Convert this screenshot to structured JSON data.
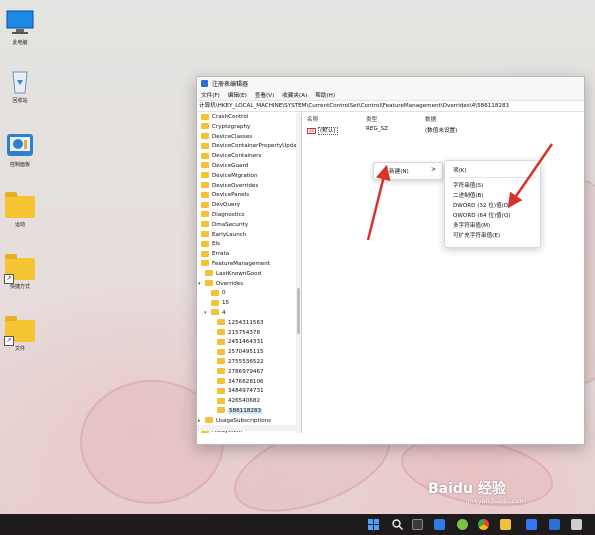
{
  "desktop": {
    "icons": [
      {
        "name": "this-pc-icon",
        "label": "此电脑"
      },
      {
        "name": "recycle-bin-icon",
        "label": "回收站"
      },
      {
        "name": "control-panel-icon",
        "label": "控制面板"
      },
      {
        "name": "folder-icon",
        "label": "运动"
      },
      {
        "name": "folder-shortcut-icon",
        "label": "快捷方式"
      },
      {
        "name": "folder-shortcut-icon",
        "label": "文件"
      }
    ]
  },
  "window": {
    "title": "注册表编辑器",
    "menu": [
      "文件(F)",
      "编辑(E)",
      "查看(V)",
      "收藏夹(A)",
      "帮助(H)"
    ],
    "address": "计算机\\HKEY_LOCAL_MACHINE\\SYSTEM\\CurrentControlSet\\Control\\FeatureManagement\\Overrides\\4\\586118283",
    "tree": [
      {
        "label": "CrashControl",
        "indent": 0
      },
      {
        "label": "Cryptography",
        "indent": 0
      },
      {
        "label": "DeviceClasses",
        "indent": 0
      },
      {
        "label": "DeviceContainerPropertyUpda",
        "indent": 0
      },
      {
        "label": "DeviceContainers",
        "indent": 0
      },
      {
        "label": "DeviceGuard",
        "indent": 0
      },
      {
        "label": "DeviceMigration",
        "indent": 0
      },
      {
        "label": "DeviceOverrides",
        "indent": 0
      },
      {
        "label": "DevicePanels",
        "indent": 0
      },
      {
        "label": "DevQuery",
        "indent": 0
      },
      {
        "label": "Diagnostics",
        "indent": 0
      },
      {
        "label": "DmaSecurity",
        "indent": 0
      },
      {
        "label": "EarlyLaunch",
        "indent": 0
      },
      {
        "label": "Els",
        "indent": 0
      },
      {
        "label": "Errata",
        "indent": 0
      },
      {
        "label": "FeatureManagement",
        "indent": 0
      },
      {
        "label": "LastKnownGood",
        "indent": 1
      },
      {
        "label": "Overrides",
        "indent": 1,
        "expanded": true
      },
      {
        "label": "0",
        "indent": 2
      },
      {
        "label": "15",
        "indent": 2
      },
      {
        "label": "4",
        "indent": 2,
        "expanded": true
      },
      {
        "label": "1254311563",
        "indent": 3
      },
      {
        "label": "215754378",
        "indent": 3
      },
      {
        "label": "2451464331",
        "indent": 3
      },
      {
        "label": "2570495115",
        "indent": 3
      },
      {
        "label": "2755536522",
        "indent": 3
      },
      {
        "label": "2786979467",
        "indent": 3
      },
      {
        "label": "3476628106",
        "indent": 3
      },
      {
        "label": "3484974731",
        "indent": 3
      },
      {
        "label": "426540682",
        "indent": 3
      },
      {
        "label": "586118283",
        "indent": 3,
        "selected": true
      },
      {
        "label": "UsageSubscriptions",
        "indent": 1,
        "collapsed": true
      },
      {
        "label": "FileSystem",
        "indent": 0
      }
    ],
    "columns": {
      "name": "名称",
      "type": "类型",
      "data": "数据"
    },
    "values": [
      {
        "badge": "ab",
        "name": "(默认)",
        "type": "REG_SZ",
        "data": "(数值未设置)"
      }
    ]
  },
  "context_menu": {
    "new_label": "新建(N)",
    "chevron": ">",
    "submenu": [
      "项(K)",
      "字符串值(S)",
      "二进制值(B)",
      "DWORD (32 位)值(D)",
      "QWORD (64 位)值(Q)",
      "多字符串值(M)",
      "可扩充字符串值(E)"
    ]
  },
  "watermark": {
    "brand": "Baidu 经验",
    "url": "jingyan.baidu.com"
  },
  "colors": {
    "annotation_arrow": "#d9322d",
    "selection": "#cce4f7",
    "folder": "#f3c236"
  }
}
